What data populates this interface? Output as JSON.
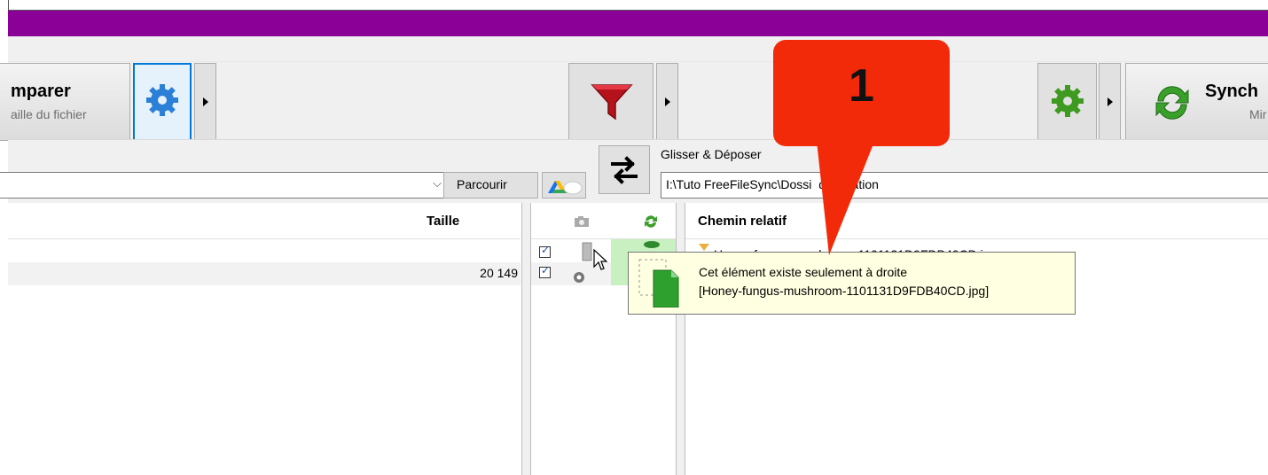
{
  "toolbar": {
    "compare": {
      "title": "mparer",
      "subtitle": "aille du fichier"
    },
    "sync": {
      "title": "Synch",
      "subtitle": "Mir"
    }
  },
  "paths": {
    "drag_drop_label": "Glisser & Déposer",
    "browse_label": "Parcourir",
    "right_path": "I:\\Tuto FreeFileSync\\Dossi  destination"
  },
  "grid": {
    "left_header_size": "Taille",
    "right_header_path": "Chemin relatif",
    "rows": [
      {
        "left_size": "",
        "right_name": "Honey-fungus-mushroom-1101131D9FDB40CD.jpg"
      },
      {
        "left_size": "20 149",
        "right_name": ""
      }
    ]
  },
  "tooltip": {
    "line1": "Cet élément existe seulement à droite",
    "line2": "[Honey-fungus-mushroom-1101131D9FDB40CD.jpg]"
  },
  "annotation": {
    "number": "1"
  },
  "colors": {
    "title_bar": "#8b0096",
    "annotation": "#f22a0a",
    "tooltip_bg": "#ffffe1",
    "sync_col_bg": "#c8f0c0"
  }
}
